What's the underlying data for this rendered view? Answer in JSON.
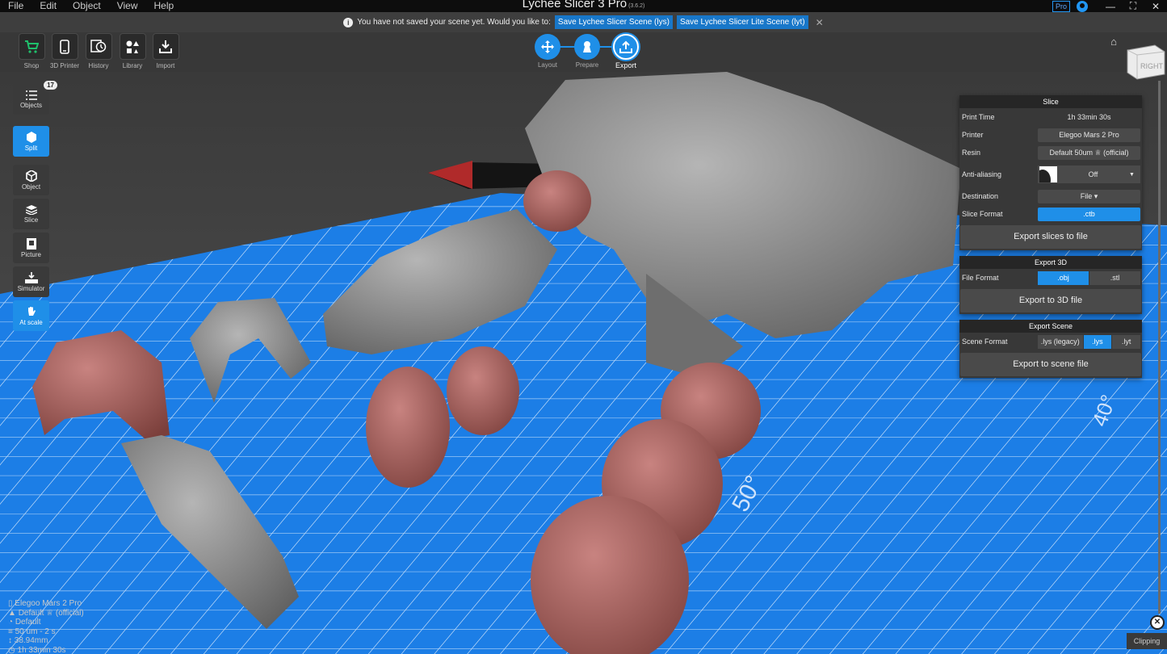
{
  "app": {
    "title": "Lychee Slicer 3 Pro",
    "version": "(3.6.2)",
    "pro_badge": "Pro"
  },
  "menu": [
    "File",
    "Edit",
    "Object",
    "View",
    "Help"
  ],
  "notification": {
    "message": "You have not saved your scene yet. Would you like to:",
    "btn_lys": "Save Lychee Slicer Scene (lys)",
    "btn_lyt": "Save Lychee Slicer Lite Scene (lyt)"
  },
  "toolbar": [
    {
      "label": "Shop",
      "icon": "cart-icon"
    },
    {
      "label": "3D Printer",
      "icon": "printer-icon"
    },
    {
      "label": "History",
      "icon": "history-icon"
    },
    {
      "label": "Library",
      "icon": "library-icon"
    },
    {
      "label": "Import",
      "icon": "import-icon"
    }
  ],
  "steps": [
    {
      "label": "Layout",
      "icon": "move-icon"
    },
    {
      "label": "Prepare",
      "icon": "supports-icon"
    },
    {
      "label": "Export",
      "icon": "export-icon",
      "active": true
    }
  ],
  "viewcube": {
    "face": "RIGHT"
  },
  "left_tools": {
    "objects": {
      "label": "Objects",
      "count": "17"
    },
    "split": {
      "label": "Split"
    },
    "object": {
      "label": "Object"
    },
    "slice": {
      "label": "Slice"
    },
    "picture": {
      "label": "Picture"
    },
    "simulator": {
      "label": "Simulator"
    },
    "atscale": {
      "label": "At scale"
    }
  },
  "slice_panel": {
    "title": "Slice",
    "print_time_label": "Print Time",
    "print_time": "1h 33min 30s",
    "printer_label": "Printer",
    "printer": "Elegoo Mars 2 Pro",
    "resin_label": "Resin",
    "resin": "Default 50um ♕ (official)",
    "aa_label": "Anti-aliasing",
    "aa_value": "Off",
    "dest_label": "Destination",
    "dest_value": "File ▾",
    "format_label": "Slice Format",
    "format_value": ".ctb",
    "export_btn": "Export slices to file"
  },
  "export3d_panel": {
    "title": "Export 3D",
    "format_label": "File Format",
    "obj": ".obj",
    "stl": ".stl",
    "export_btn": "Export to 3D file"
  },
  "scene_panel": {
    "title": "Export Scene",
    "format_label": "Scene Format",
    "lys_legacy": ".lys (legacy)",
    "lys": ".lys",
    "lyt": ".lyt",
    "export_btn": "Export to scene file"
  },
  "plate_labels": [
    "40°",
    "50°"
  ],
  "info": {
    "printer": "Elegoo Mars 2 Pro",
    "resin": "Default ♕ (official)",
    "profile": "Default",
    "layer": "50 um - 2 s",
    "height": "38.94mm",
    "time": "1h 33min 30s"
  },
  "clipping": "Clipping",
  "colors": {
    "accent": "#1f8fe8",
    "plate": "#1c7ee6",
    "model_grey": "#8a8a8a",
    "model_red": "#a5605c"
  }
}
